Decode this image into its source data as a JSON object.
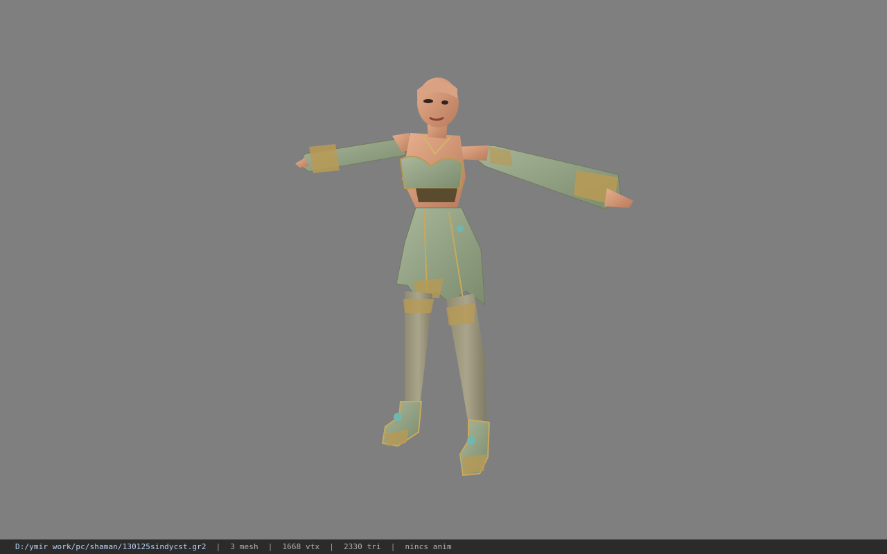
{
  "viewport": {
    "background_color": "#7f7f7f",
    "model_name": "shaman character model"
  },
  "status_bar": {
    "file_path": "D:/ymir work/pc/shaman/130125sindycst.gr2",
    "mesh_count": "3 mesh",
    "vertex_count": "1668 vtx",
    "triangle_count": "2330 tri",
    "anim_status": "nincs anim",
    "separator": "|"
  }
}
